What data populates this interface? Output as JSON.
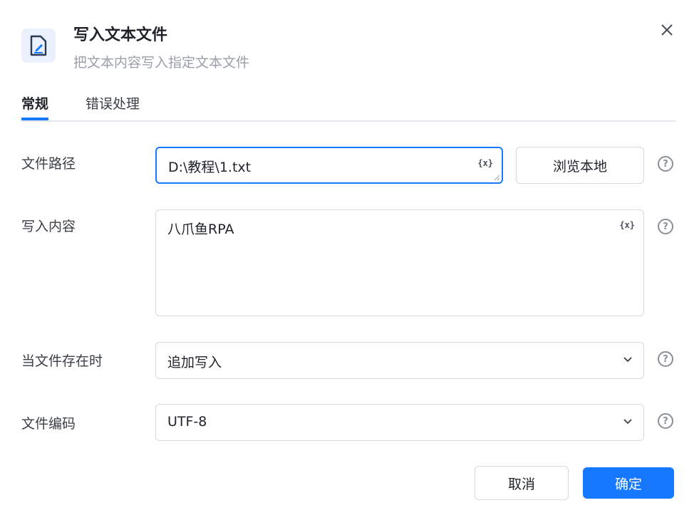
{
  "dialog": {
    "title": "写入文本文件",
    "subtitle": "把文本内容写入指定文本文件",
    "header_icon": "file-edit-icon",
    "close_icon": "close-icon"
  },
  "tabs": [
    {
      "label": "常规",
      "active": true
    },
    {
      "label": "错误处理",
      "active": false
    }
  ],
  "fields": {
    "file_path": {
      "label": "文件路径",
      "value": "D:\\教程\\1.txt",
      "variable_icon": "{x}",
      "browse_label": "浏览本地"
    },
    "content": {
      "label": "写入内容",
      "value": "八爪鱼RPA",
      "variable_icon": "{x}"
    },
    "exists_mode": {
      "label": "当文件存在时",
      "value": "追加写入"
    },
    "encoding": {
      "label": "文件编码",
      "value": "UTF-8"
    }
  },
  "help_icon_glyph": "?",
  "buttons": {
    "cancel": "取消",
    "confirm": "确定"
  },
  "colors": {
    "accent": "#1677ff",
    "icon_bg": "#eaf1fd"
  }
}
